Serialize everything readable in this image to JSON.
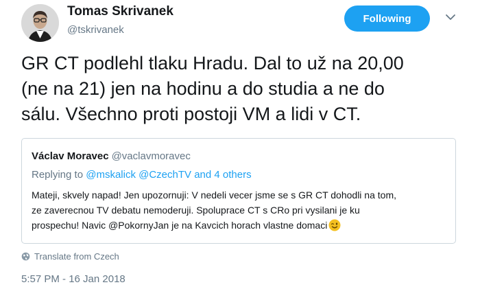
{
  "author": {
    "name": "Tomas Skrivanek",
    "handle": "@tskrivanek",
    "follow_label": "Following"
  },
  "tweet": {
    "lines": [
      "GR CT podlehl tlaku Hradu. Dal to už na 20,00",
      "(ne na 21) jen na hodinu a do studia a ne do",
      "sálu. Všechno proti postoji VM a lidi v CT."
    ]
  },
  "quoted": {
    "name": "Václav Moravec",
    "handle": "@vaclavmoravec",
    "replying_prefix": "Replying to ",
    "replying_to": "@mskalick @CzechTV and 4 others",
    "body_lines": [
      "Mateji, skvely napad! Jen upozornuji: V nedeli vecer jsme se s GR CT dohodli na tom,",
      "ze zaverecnou TV debatu nemoderuji. Spoluprace CT s CRo pri vysilani je ku",
      "prospechu! Navic @PokornyJan je na Kavcich horach vlastne domaci"
    ]
  },
  "translate_label": "Translate from Czech",
  "timestamp": "5:57 PM - 16 Jan 2018",
  "icons": {
    "avatar": "profile-photo",
    "caret": "chevron-down-icon",
    "translate": "globe-icon",
    "emoji": "winking-face-emoji"
  },
  "colors": {
    "accent": "#1da1f2",
    "secondary_text": "#657786",
    "primary_text": "#14171a",
    "border": "#ccd6dd"
  }
}
